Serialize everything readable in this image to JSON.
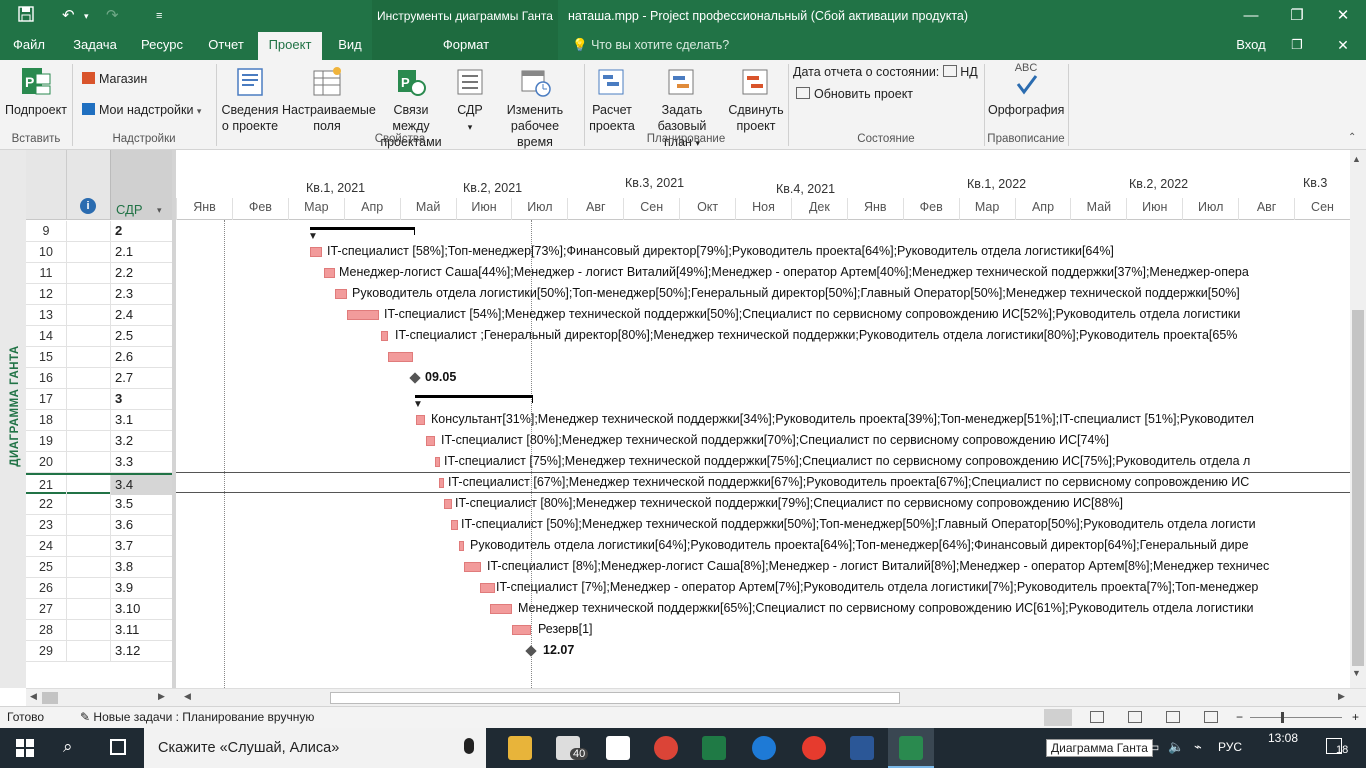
{
  "titlebar": {
    "context_tab": "Инструменты диаграммы Ганта",
    "doc_title": "наташа.mpp - Project профессиональный (Сбой активации продукта)",
    "save_icon": "save-icon",
    "undo_icon": "undo-icon",
    "redo_icon": "redo-icon",
    "customize_icon": "customize-icon",
    "minimize": "—",
    "restore": "❐",
    "close": "✕"
  },
  "tabs": [
    "Файл",
    "Задача",
    "Ресурс",
    "Отчет",
    "Проект",
    "Вид"
  ],
  "context_tab_format": "Формат",
  "tell_me": "Что вы хотите сделать?",
  "signin": "Вход",
  "ribbon": {
    "subproject": "Подпроект",
    "store": "Магазин",
    "my_addins": "Мои надстройки",
    "project_info": [
      "Сведения",
      "о проекте"
    ],
    "custom_fields": [
      "Настраиваемые",
      "поля"
    ],
    "links": [
      "Связи между",
      "проектами"
    ],
    "wbs": "СДР",
    "change_time": [
      "Изменить",
      "рабочее время"
    ],
    "calc": [
      "Расчет",
      "проекта"
    ],
    "baseline": [
      "Задать базовый",
      "план"
    ],
    "move": [
      "Сдвинуть",
      "проект"
    ],
    "status_date_label": "Дата отчета о состоянии:",
    "status_date_value": "НД",
    "update_project": "Обновить проект",
    "spelling": "Орфография",
    "abc": "ABC",
    "groups": [
      "Вставить",
      "Надстройки",
      "Свойства",
      "Планирование",
      "Состояние",
      "Правописание"
    ]
  },
  "side_title": "ДИАГРАММА ГАНТА",
  "grid": {
    "col_wbs": "СДР",
    "rows": [
      {
        "n": "9",
        "w": "2",
        "bold": true
      },
      {
        "n": "10",
        "w": "2.1"
      },
      {
        "n": "11",
        "w": "2.2"
      },
      {
        "n": "12",
        "w": "2.3"
      },
      {
        "n": "13",
        "w": "2.4"
      },
      {
        "n": "14",
        "w": "2.5"
      },
      {
        "n": "15",
        "w": "2.6"
      },
      {
        "n": "16",
        "w": "2.7"
      },
      {
        "n": "17",
        "w": "3",
        "bold": true
      },
      {
        "n": "18",
        "w": "3.1"
      },
      {
        "n": "19",
        "w": "3.2"
      },
      {
        "n": "20",
        "w": "3.3"
      },
      {
        "n": "21",
        "w": "3.4",
        "selected": true
      },
      {
        "n": "22",
        "w": "3.5"
      },
      {
        "n": "23",
        "w": "3.6"
      },
      {
        "n": "24",
        "w": "3.7"
      },
      {
        "n": "25",
        "w": "3.8"
      },
      {
        "n": "26",
        "w": "3.9"
      },
      {
        "n": "27",
        "w": "3.10"
      },
      {
        "n": "28",
        "w": "3.11"
      },
      {
        "n": "29",
        "w": "3.12"
      }
    ]
  },
  "timescale": {
    "quarters": [
      "Кв.1, 2021",
      "Кв.2, 2021",
      "Кв.3, 2021",
      "Кв.4, 2021",
      "Кв.1, 2022",
      "Кв.2, 2022",
      "Кв.3"
    ],
    "months": [
      "Янв",
      "Фев",
      "Мар",
      "Апр",
      "Май",
      "Июн",
      "Июл",
      "Авг",
      "Сен",
      "Окт",
      "Ноя",
      "Дек",
      "Янв",
      "Фев",
      "Мар",
      "Апр",
      "Май",
      "Июн",
      "Июл",
      "Авг",
      "Сен"
    ]
  },
  "gantt_labels": [
    "",
    "IT-специалист [58%];Топ-менеджер[73%];Финансовый директор[79%];Руководитель проекта[64%];Руководитель отдела логистики[64%]",
    "Менеджер-логист Саша[44%];Менеджер - логист Виталий[49%];Менеджер - оператор Артем[40%];Менеджер технической поддержки[37%];Менеджер-опера",
    "Руководитель отдела логистики[50%];Топ-менеджер[50%];Генеральный директор[50%];Главный Оператор[50%];Менеджер технической поддержки[50%]",
    "IT-специалист [54%];Менеджер технической поддержки[50%];Специалист по сервисному сопровождению ИС[52%];Руководитель отдела логистики",
    "IT-специалист ;Генеральный директор[80%];Менеджер технической поддержки;Руководитель отдела логистики[80%];Руководитель проекта[65%",
    "",
    "09.05",
    "",
    "Консультант[31%];Менеджер технической поддержки[34%];Руководитель проекта[39%];Топ-менеджер[51%];IT-специалист [51%];Руководител",
    "IT-специалист [80%];Менеджер технической поддержки[70%];Специалист по сервисному сопровождению ИС[74%]",
    "IT-специалист [75%];Менеджер технической поддержки[75%];Специалист по сервисному сопровождению ИС[75%];Руководитель отдела л",
    "IT-специалист [67%];Менеджер технической поддержки[67%];Руководитель проекта[67%];Специалист по сервисному сопровождению ИС",
    "IT-специалист [80%];Менеджер технической поддержки[79%];Специалист по сервисному сопровождению ИС[88%]",
    "IT-специалист [50%];Менеджер технической поддержки[50%];Топ-менеджер[50%];Главный Оператор[50%];Руководитель отдела логисти",
    "Руководитель отдела логистики[64%];Руководитель проекта[64%];Топ-менеджер[64%];Финансовый директор[64%];Генеральный дире",
    "IT-специалист [8%];Менеджер-логист Саша[8%];Менеджер - логист Виталий[8%];Менеджер - оператор Артем[8%];Менеджер техничес",
    "IT-специалист [7%];Менеджер - оператор Артем[7%];Руководитель отдела логистики[7%];Руководитель проекта[7%];Топ-менеджер",
    "Менеджер технической поддержки[65%];Специалист по сервисному сопровождению ИС[61%];Руководитель отдела логистики",
    "Резерв[1]",
    "12.07"
  ],
  "status": {
    "ready": "Готово",
    "new_tasks": "Новые задачи : Планирование вручную"
  },
  "taskbar": {
    "search": "Скажите «Слушай, Алиса»",
    "mail_badge": "40",
    "tooltip": "Диаграмма Ганта",
    "lang": "РУС",
    "time": "13:08",
    "notif_count": "18"
  }
}
